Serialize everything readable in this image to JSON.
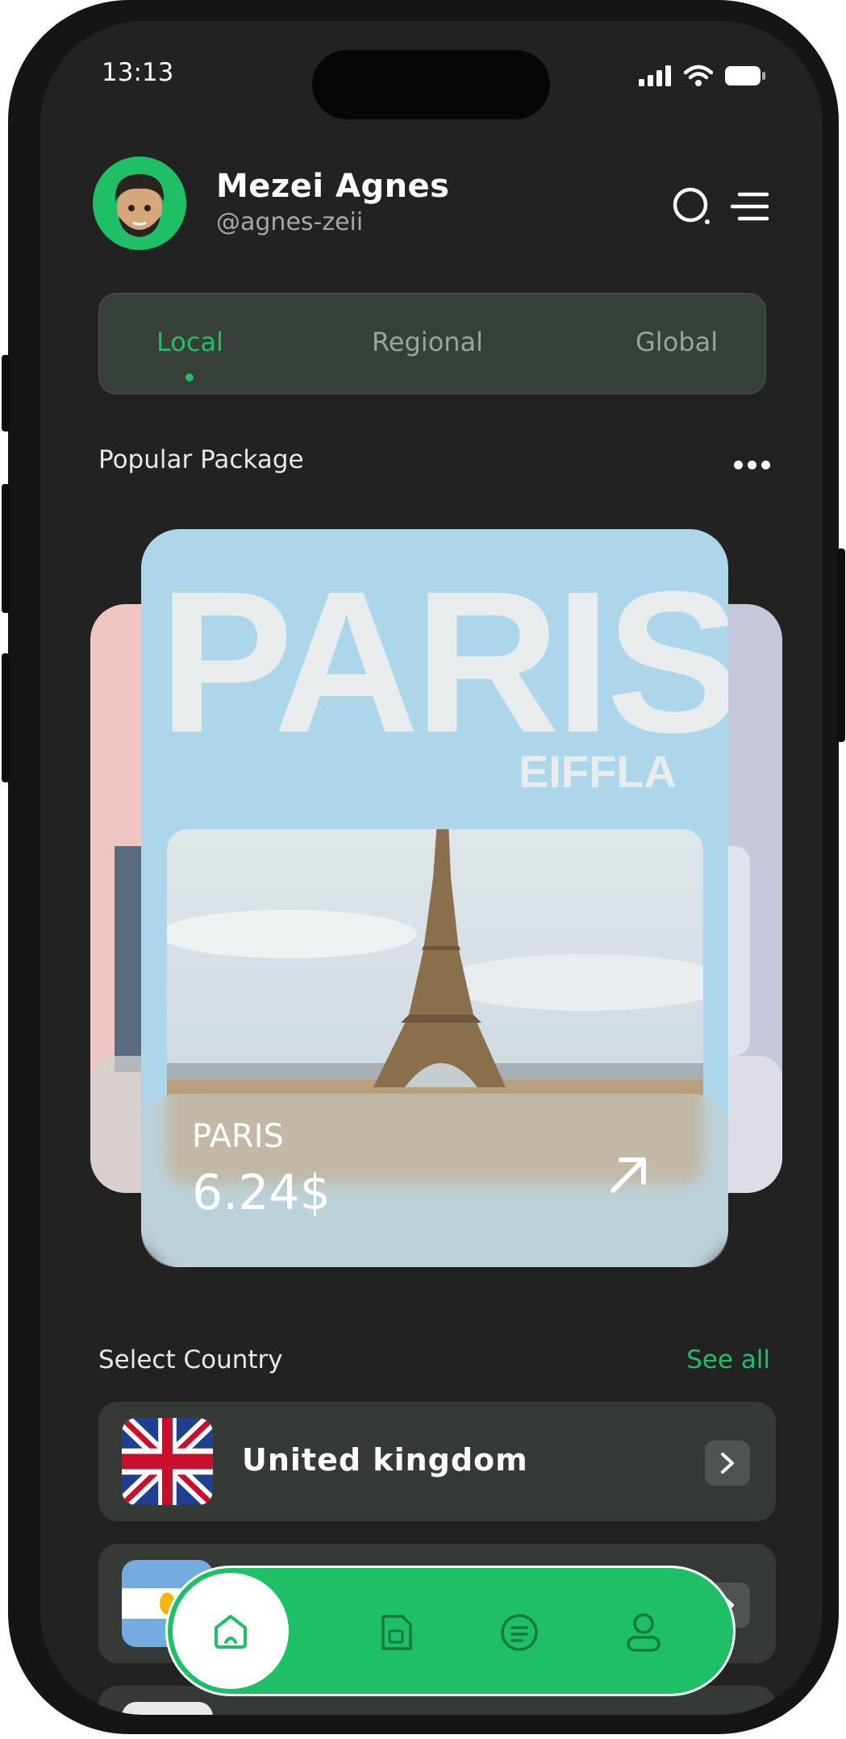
{
  "status": {
    "time": "13:13"
  },
  "profile": {
    "name": "Mezei Agnes",
    "handle": "@agnes-zeii"
  },
  "tabs": [
    {
      "label": "Local",
      "active": true
    },
    {
      "label": "Regional",
      "active": false
    },
    {
      "label": "Global",
      "active": false
    }
  ],
  "popular": {
    "title": "Popular Package",
    "card": {
      "headline": "PARIS",
      "subheadline": "EIFFLA",
      "name": "PARIS",
      "price": "6.24$"
    }
  },
  "countries": {
    "title": "Select Country",
    "see_all": "See all",
    "items": [
      {
        "name": "United kingdom",
        "flag": "uk-flag"
      },
      {
        "name": "",
        "flag": "argentina-flag"
      }
    ]
  },
  "nav": {
    "items": [
      "home-icon",
      "sim-card-icon",
      "document-icon",
      "profile-icon"
    ],
    "active": "home-icon"
  },
  "colors": {
    "accent": "#1fbf68",
    "background": "#222222",
    "card": "#acd7ea"
  }
}
